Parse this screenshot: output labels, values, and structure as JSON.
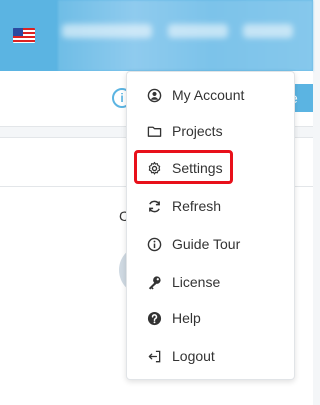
{
  "header": {
    "locale_flag": "us-flag-icon"
  },
  "toolbar": {
    "info_icon_glyph": "i",
    "action_button_partial": "e"
  },
  "main": {
    "panel_heading_partial": "C"
  },
  "user_menu": {
    "items": [
      {
        "label": "My Account",
        "icon": "account-circle-icon"
      },
      {
        "label": "Projects",
        "icon": "folder-icon"
      },
      {
        "label": "Settings",
        "icon": "gear-icon"
      },
      {
        "label": "Refresh",
        "icon": "refresh-icon"
      },
      {
        "label": "Guide Tour",
        "icon": "info-icon"
      },
      {
        "label": "License",
        "icon": "key-icon"
      },
      {
        "label": "Help",
        "icon": "help-icon"
      },
      {
        "label": "Logout",
        "icon": "logout-icon"
      }
    ],
    "highlighted_item": "Settings",
    "highlight_color": "#e8101a"
  },
  "colors": {
    "brand": "#5bb4e2",
    "text": "#333333"
  }
}
